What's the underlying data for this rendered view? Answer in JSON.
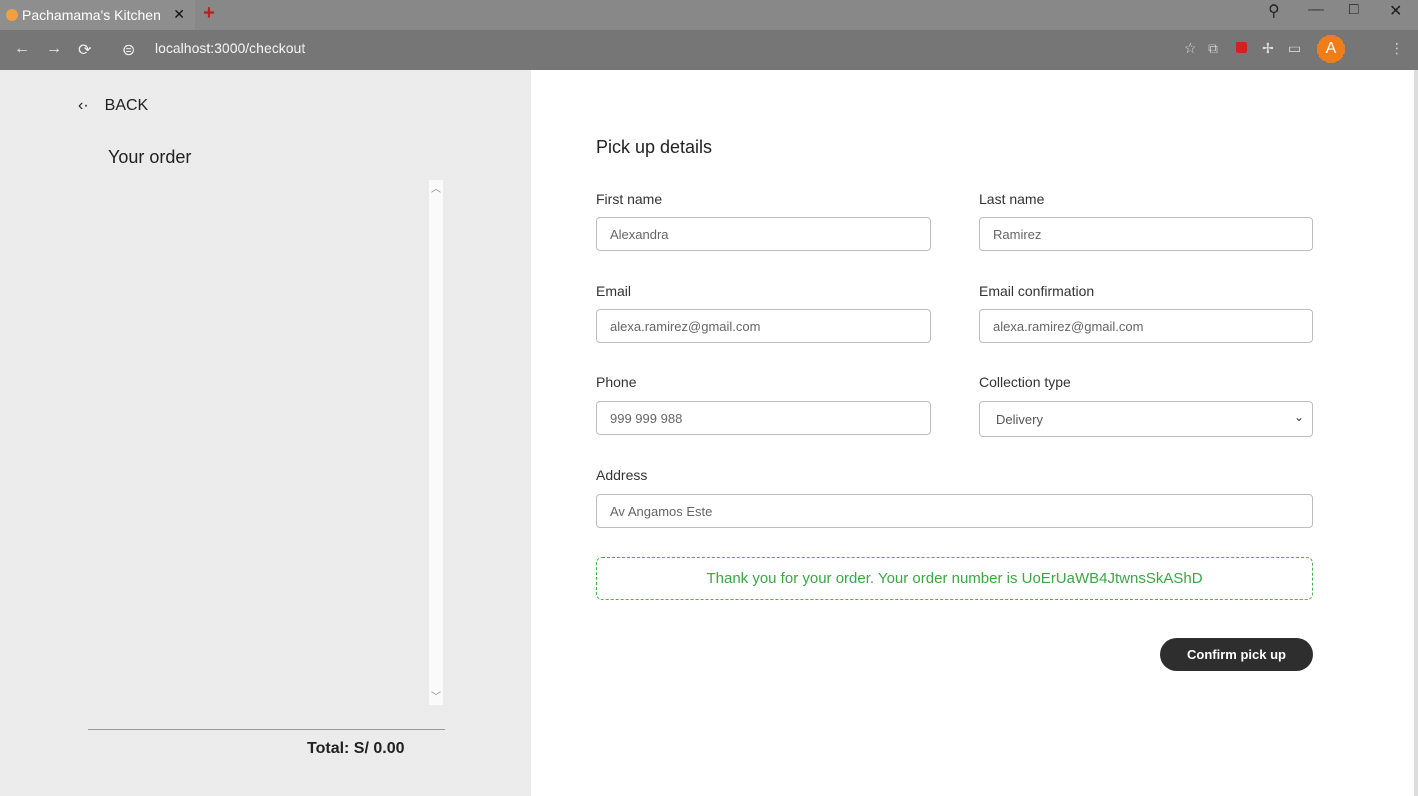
{
  "browser": {
    "tab_title": "Pachamama's Kitchen",
    "tab_close": "✕",
    "new_tab": "+",
    "address": "localhost:3000/checkout",
    "avatar_letter": "A",
    "window_controls": [
      "—",
      "□",
      "✕"
    ]
  },
  "left": {
    "back_label": "BACK",
    "order_title": "Your order",
    "total_label": "Total: S/ 0.00"
  },
  "form": {
    "title": "Pick up details",
    "first_name": {
      "label": "First name",
      "value": "Alexandra"
    },
    "last_name": {
      "label": "Last name",
      "value": "Ramirez"
    },
    "email": {
      "label": "Email",
      "value": "alexa.ramirez@gmail.com"
    },
    "email_confirm": {
      "label": "Email confirmation",
      "value": "alexa.ramirez@gmail.com"
    },
    "phone": {
      "label": "Phone",
      "value": "999 999 988"
    },
    "collection_type": {
      "label": "Collection type",
      "value": "Delivery"
    },
    "address": {
      "label": "Address",
      "value": "Av Angamos Este"
    },
    "success_message": "Thank you for your order. Your order number is UoErUaWB4JtwnsSkAShD",
    "confirm_button": "Confirm pick up"
  },
  "colors": {
    "success": "#3aa745",
    "button": "#2e2e2e",
    "avatar": "#ef7d1a"
  }
}
